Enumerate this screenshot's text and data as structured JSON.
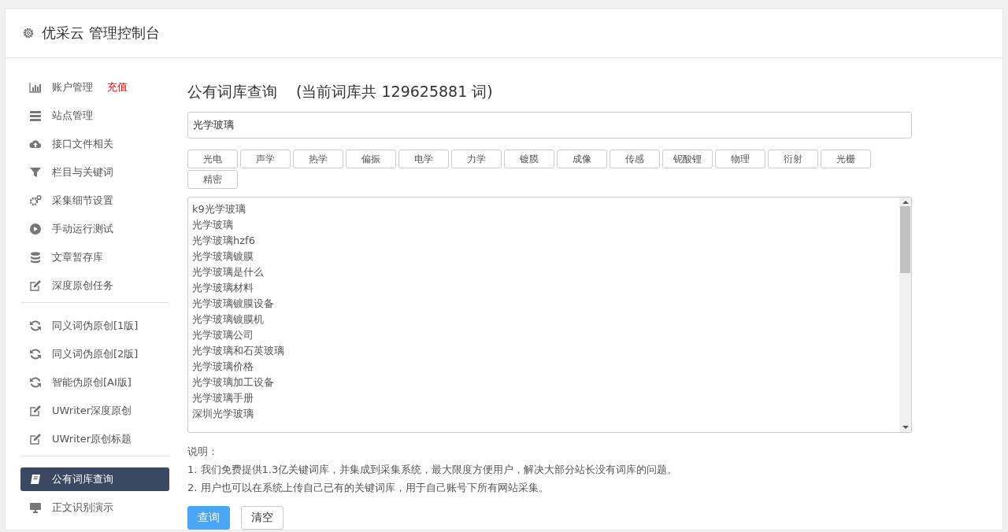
{
  "header": {
    "title": "优采云 管理控制台"
  },
  "sidebar": {
    "sections": [
      {
        "items": [
          {
            "label": "账户管理",
            "badge": "充值",
            "selected": false
          },
          {
            "label": "站点管理",
            "selected": false
          },
          {
            "label": "接口文件相关",
            "selected": false
          },
          {
            "label": "栏目与关键词",
            "selected": false
          },
          {
            "label": "采集细节设置",
            "selected": false
          },
          {
            "label": "手动运行测试",
            "selected": false
          },
          {
            "label": "文章暂存库",
            "selected": false
          },
          {
            "label": "深度原创任务",
            "selected": false
          }
        ]
      },
      {
        "items": [
          {
            "label": "同义词伪原创[1版]",
            "selected": false
          },
          {
            "label": "同义词伪原创[2版]",
            "selected": false
          },
          {
            "label": "智能伪原创[AI版]",
            "selected": false
          },
          {
            "label": "UWriter深度原创",
            "selected": false
          },
          {
            "label": "UWriter原创标题",
            "selected": false
          }
        ]
      },
      {
        "items": [
          {
            "label": "公有词库查询",
            "selected": true
          },
          {
            "label": "正文识别演示",
            "selected": false
          }
        ]
      }
    ]
  },
  "main": {
    "title": "公有词库查询",
    "subtitle": "(当前词库共 129625881 词)",
    "search": {
      "value": "光学玻璃"
    },
    "tags": [
      "光电",
      "声学",
      "热学",
      "偏振",
      "电学",
      "力学",
      "镀膜",
      "成像",
      "传感",
      "铌酸锂",
      "物理",
      "衍射",
      "光栅",
      "精密"
    ],
    "results": [
      "k9光学玻璃",
      "光学玻璃",
      "光学玻璃hzf6",
      "光学玻璃镀膜",
      "光学玻璃是什么",
      "光学玻璃材料",
      "光学玻璃镀膜设备",
      "光学玻璃镀膜机",
      "光学玻璃公司",
      "光学玻璃和石英玻璃",
      "光学玻璃价格",
      "光学玻璃加工设备",
      "光学玻璃手册",
      "深圳光学玻璃"
    ],
    "notes_title": "说明：",
    "notes": [
      "1. 我们免费提供1.3亿关键词库，并集成到采集系统，最大限度方便用户，解决大部分站长没有词库的问题。",
      "2. 用户也可以在系统上传自己已有的关键词库，用于自己账号下所有网站采集。"
    ],
    "buttons": [
      {
        "label": "查询",
        "kind": "primary"
      },
      {
        "label": "清空",
        "kind": "default"
      }
    ]
  }
}
